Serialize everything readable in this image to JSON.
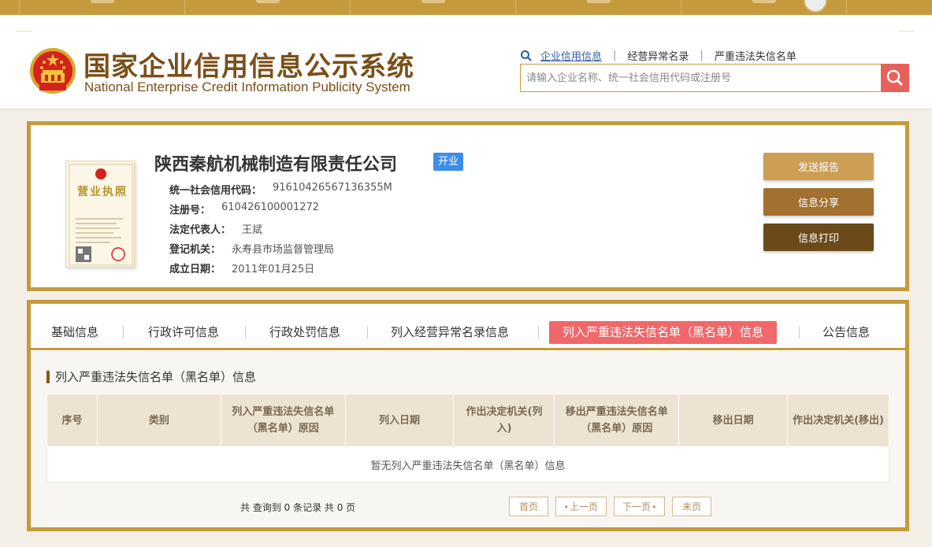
{
  "header": {
    "title": "国家企业信用信息公示系统",
    "subtitle": "National Enterprise Credit Information Publicity System"
  },
  "search": {
    "links": [
      "企业信用信息",
      "经营异常名录",
      "严重违法失信名单"
    ],
    "placeholder": "请输入企业名称、统一社会信用代码或注册号"
  },
  "company": {
    "name": "陕西秦航机械制造有限责任公司",
    "status": "开业",
    "fields": [
      {
        "key": "统一社会信用代码：",
        "value": "91610426567136355M"
      },
      {
        "key": "注册号：",
        "value": "610426100001272"
      },
      {
        "key": "法定代表人：",
        "value": "王斌"
      },
      {
        "key": "登记机关：",
        "value": "永寿县市场监督管理局"
      },
      {
        "key": "成立日期：",
        "value": "2011年01月25日"
      }
    ],
    "license_label": "营业执照"
  },
  "actions": {
    "send_report": "发送报告",
    "share": "信息分享",
    "print": "信息打印"
  },
  "tabs": [
    "基础信息",
    "行政许可信息",
    "行政处罚信息",
    "列入经营异常名录信息",
    "列入严重违法失信名单（黑名单）信息",
    "公告信息"
  ],
  "section": {
    "title": "列入严重违法失信名单（黑名单）信息"
  },
  "table": {
    "headers": [
      "序号",
      "类别",
      "列入严重违法失信名单（黑名单）原因",
      "列入日期",
      "作出决定机关(列入)",
      "移出严重违法失信名单（黑名单）原因",
      "移出日期",
      "作出决定机关(移出)"
    ],
    "empty_text": "暂无列入严重违法失信名单（黑名单）信息"
  },
  "pager": {
    "info": "共 查询到 0 条记录 共 0 页",
    "first": "首页",
    "prev": "上一页",
    "next": "下一页",
    "last": "末页"
  },
  "colors": {
    "gold": "#c59a3d",
    "brown": "#7b4f19",
    "active_tab": "#f0686a",
    "status_blue": "#3d8ee6",
    "btn_report": "#cd9f55",
    "btn_share": "#a2702f",
    "btn_print": "#6b4a1a"
  }
}
